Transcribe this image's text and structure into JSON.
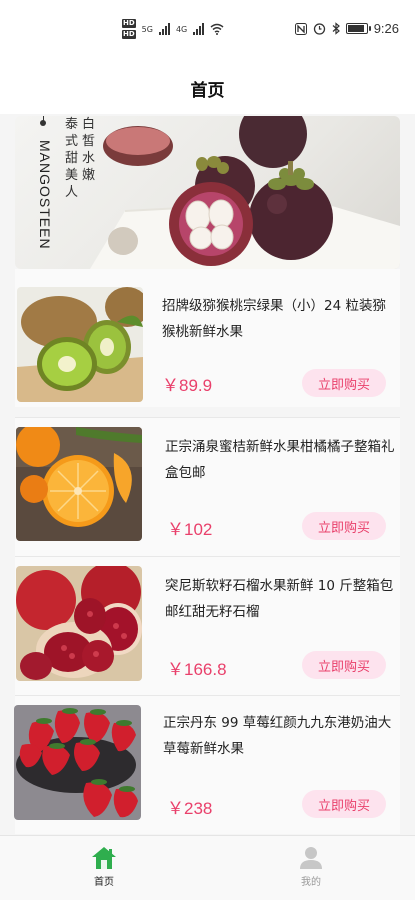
{
  "status_bar": {
    "hd1": "HD",
    "hd2": "HD",
    "net1": "5G",
    "net2": "4G",
    "time": "9:26"
  },
  "nav": {
    "title": "首页"
  },
  "banner": {
    "english_text": "MANGOSTEEN",
    "slogan_col1": [
      "白",
      "皙",
      "水",
      "嫩"
    ],
    "slogan_col2": [
      "泰",
      "式",
      "甜",
      "美",
      "人"
    ]
  },
  "products": [
    {
      "name": "招牌级猕猴桃宗绿果（小）24 粒装猕猴桃新鲜水果",
      "price": "￥89.9",
      "buy_label": "立即购买",
      "image": "kiwi"
    },
    {
      "name": "正宗涌泉蜜桔新鲜水果柑橘橘子整箱礼盒包邮",
      "price": "￥102",
      "buy_label": "立即购买",
      "image": "orange"
    },
    {
      "name": "突尼斯软籽石榴水果新鲜 10 斤整箱包邮红甜无籽石榴",
      "price": "￥166.8",
      "buy_label": "立即购买",
      "image": "pomegranate"
    },
    {
      "name": "正宗丹东 99 草莓红颜九九东港奶油大草莓新鲜水果",
      "price": "￥238",
      "buy_label": "立即购买",
      "image": "strawberry"
    }
  ],
  "tabbar": {
    "home_label": "首页",
    "mine_label": "我的"
  },
  "colors": {
    "accent": "#e9406b",
    "button_bg": "#fde3ee",
    "home_tab": "#2fae4e",
    "inactive_tab": "#999999"
  }
}
